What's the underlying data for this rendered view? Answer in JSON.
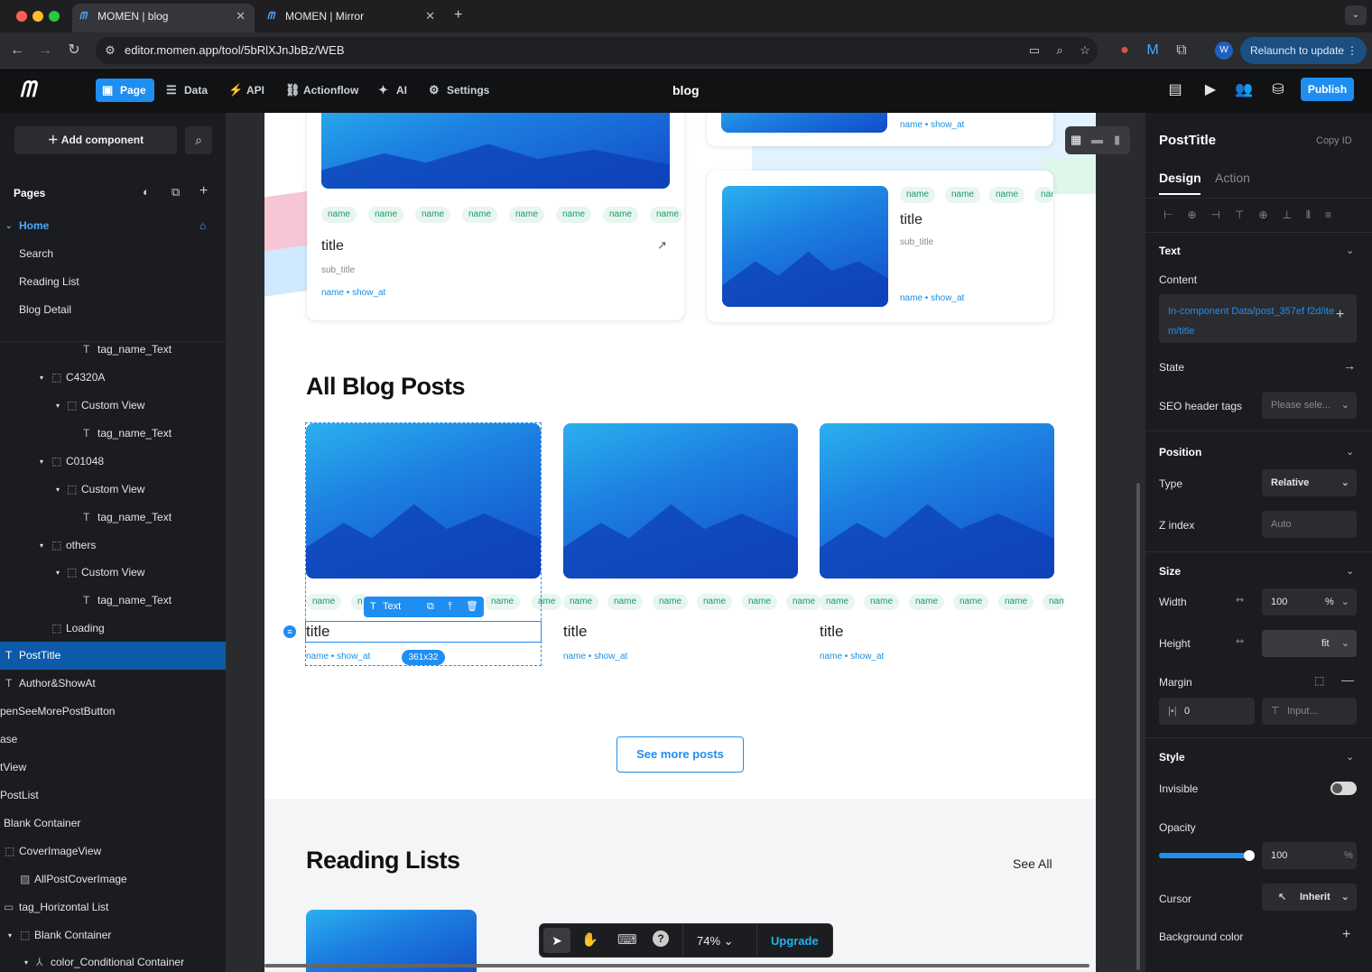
{
  "browser": {
    "tabs": [
      {
        "title": "MOMEN | blog",
        "active": true
      },
      {
        "title": "MOMEN | Mirror",
        "active": false
      }
    ],
    "url": "editor.momen.app/tool/5bRlXJnJbBz/WEB",
    "relaunch_label": "Relaunch to update",
    "profile_initial": "W"
  },
  "header": {
    "nav": [
      {
        "label": "Page",
        "icon": "page-icon"
      },
      {
        "label": "Data",
        "icon": "database-icon"
      },
      {
        "label": "API",
        "icon": "api-icon"
      },
      {
        "label": "Actionflow",
        "icon": "actionflow-icon"
      },
      {
        "label": "AI",
        "icon": "ai-icon"
      },
      {
        "label": "Settings",
        "icon": "gear-icon"
      }
    ],
    "project_title": "blog",
    "publish_label": "Publish"
  },
  "left": {
    "add_component_label": "Add component",
    "pages_heading": "Pages",
    "pages": [
      "Home",
      "Search",
      "Reading List",
      "Blog Detail"
    ],
    "tree": [
      {
        "label": "tag_name_Text",
        "kind": "text"
      },
      {
        "label": "C4320A",
        "kind": "container"
      },
      {
        "label": "Custom View",
        "kind": "container"
      },
      {
        "label": "tag_name_Text",
        "kind": "text"
      },
      {
        "label": "C01048",
        "kind": "container"
      },
      {
        "label": "Custom View",
        "kind": "container"
      },
      {
        "label": "tag_name_Text",
        "kind": "text"
      },
      {
        "label": "others",
        "kind": "container"
      },
      {
        "label": "Custom View",
        "kind": "container"
      },
      {
        "label": "tag_name_Text",
        "kind": "text"
      },
      {
        "label": "Loading",
        "kind": "container"
      },
      {
        "label": "PostTitle",
        "kind": "text",
        "selected": true
      },
      {
        "label": "Author&ShowAt",
        "kind": "text"
      },
      {
        "label": "penSeeMorePostButton",
        "kind": "plain"
      },
      {
        "label": "ase",
        "kind": "plain"
      },
      {
        "label": "tView",
        "kind": "plain"
      },
      {
        "label": "PostList",
        "kind": "plain"
      },
      {
        "label": "Blank Container",
        "kind": "plain"
      },
      {
        "label": "CoverImageView",
        "kind": "container"
      },
      {
        "label": "AllPostCoverImage",
        "kind": "image"
      },
      {
        "label": "tag_Horizontal List",
        "kind": "list"
      },
      {
        "label": "Blank Container",
        "kind": "container"
      },
      {
        "label": "color_Conditional Container",
        "kind": "conditional"
      }
    ]
  },
  "canvas": {
    "top_cards": [
      {
        "tags": [
          "name",
          "name",
          "name",
          "name",
          "name",
          "name",
          "name",
          "name",
          "n"
        ],
        "title": "title",
        "subtitle": "sub_title",
        "meta": "name • show_at"
      },
      {
        "tags": [
          "name",
          "name",
          "name",
          "name"
        ],
        "title": "title",
        "subtitle": "sub_title",
        "meta": "name • show_at"
      }
    ],
    "top_right_meta": "name • show_at",
    "all_posts_heading": "All Blog Posts",
    "posts": [
      {
        "tags": [
          "name",
          "n",
          "name",
          "name"
        ],
        "title": "title",
        "meta": "name • show_at"
      },
      {
        "tags": [
          "ame",
          "name",
          "name",
          "name",
          "name",
          "name",
          "name"
        ],
        "title": "title",
        "meta": "name • show_at"
      },
      {
        "tags": [
          "name",
          "name",
          "name",
          "name",
          "name",
          "name",
          "n"
        ],
        "title": "title",
        "meta": "name • show_at"
      }
    ],
    "selection_label": "Text",
    "selection_size": "361x32",
    "see_more_label": "See more posts",
    "reading_lists_heading": "Reading Lists",
    "see_all_label": "See All"
  },
  "right": {
    "component_name": "PostTitle",
    "copy_id_label": "Copy ID",
    "tabs": [
      "Design",
      "Action"
    ],
    "text_section": "Text",
    "content_label": "Content",
    "content_value": "In-component Data/post_357ef f2d/item/title",
    "state_label": "State",
    "seo_label": "SEO header tags",
    "seo_placeholder": "Please sele...",
    "position_section": "Position",
    "type_label": "Type",
    "type_value": "Relative",
    "zindex_label": "Z index",
    "zindex_value": "Auto",
    "size_section": "Size",
    "width_label": "Width",
    "width_value": "100",
    "width_unit": "%",
    "height_label": "Height",
    "height_value": "fit",
    "margin_label": "Margin",
    "margin_value": "0",
    "margin_placeholder": "Input...",
    "style_section": "Style",
    "invisible_label": "Invisible",
    "opacity_label": "Opacity",
    "opacity_value": "100",
    "opacity_unit": "%",
    "opacity_level": 1.0,
    "cursor_label": "Cursor",
    "cursor_value": "Inherit",
    "bg_label": "Background color"
  },
  "toolbar": {
    "zoom": "74%",
    "upgrade_label": "Upgrade"
  },
  "colors": {
    "accent": "#1f8ef1",
    "selection": "#0d5aa8",
    "tag_green": "#1a9a6c",
    "meta_blue": "#1a8fe3"
  }
}
